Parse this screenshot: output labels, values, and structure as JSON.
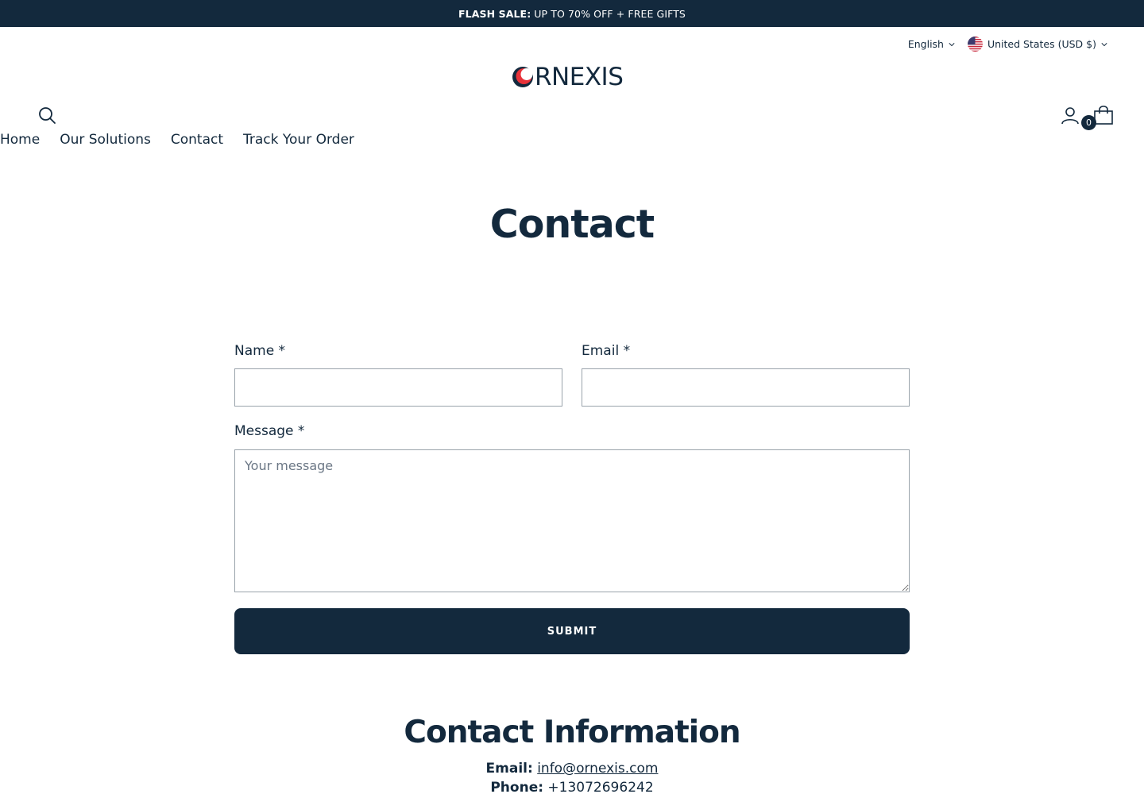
{
  "announcement": {
    "highlight": "FLASH SALE:",
    "text": "UP TO 70% OFF + FREE GIFTS"
  },
  "localization": {
    "language": "English",
    "country": "United States (USD $)",
    "flag_icon": "us-flag-icon"
  },
  "header": {
    "logo_text": "RNEXIS",
    "logo_letter": "O",
    "cart_count": "0"
  },
  "nav": {
    "items": [
      "Home",
      "Our Solutions",
      "Contact",
      "Track Your Order"
    ]
  },
  "page": {
    "title": "Contact"
  },
  "form": {
    "name_label": "Name *",
    "email_label": "Email *",
    "message_label": "Message *",
    "message_placeholder": "Your message",
    "submit_label": "SUBMIT"
  },
  "contact_info": {
    "title": "Contact Information",
    "email_label": "Email:",
    "email_value": "info@ornexis.com",
    "phone_label": "Phone:",
    "phone_value": "+13072696242"
  },
  "colors": {
    "brand_navy": "#13293d",
    "accent_red": "#e8333a"
  }
}
